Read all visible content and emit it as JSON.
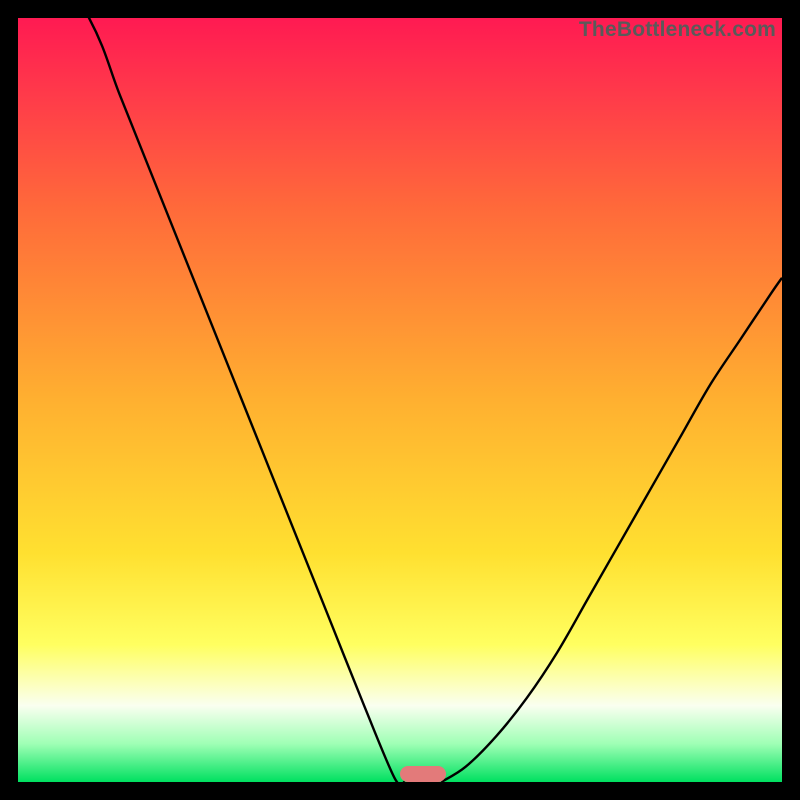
{
  "watermark": {
    "text": "TheBottleneck.com"
  },
  "marker": {
    "cx_pct": 53.0,
    "cy_pct": 99.0
  },
  "chart_data": {
    "type": "line",
    "title": "",
    "xlabel": "",
    "ylabel": "",
    "xlim": [
      0,
      100
    ],
    "ylim": [
      0,
      100
    ],
    "grid": false,
    "legend": false,
    "annotations": [
      {
        "text": "TheBottleneck.com",
        "position": "top-right"
      }
    ],
    "optimum_marker": {
      "x": 53,
      "y": 0,
      "color": "#e37a7a",
      "shape": "pill"
    },
    "series": [
      {
        "name": "bottleneck-left",
        "x": [
          0,
          9.3,
          13.3,
          17.3,
          21.3,
          25.3,
          29.3,
          33.3,
          37.3,
          41.3,
          45.3,
          49.3,
          50.6
        ],
        "values": [
          115,
          100,
          90,
          80,
          70,
          60,
          50,
          40,
          30,
          20,
          10,
          0.5,
          0
        ]
      },
      {
        "name": "bottleneck-right",
        "x": [
          55.4,
          58.6,
          62.6,
          66.6,
          70.6,
          74.6,
          78.6,
          82.6,
          86.6,
          90.6,
          94.6,
          98.6,
          100
        ],
        "values": [
          0,
          2,
          6,
          11,
          17,
          24,
          31,
          38,
          45,
          52,
          58,
          64,
          66
        ]
      }
    ],
    "background_gradient": {
      "direction": "vertical",
      "stops": [
        {
          "pct": 0,
          "color": "#ff1a52"
        },
        {
          "pct": 10,
          "color": "#ff3a4a"
        },
        {
          "pct": 25,
          "color": "#ff6a3a"
        },
        {
          "pct": 50,
          "color": "#ffb030"
        },
        {
          "pct": 70,
          "color": "#ffe030"
        },
        {
          "pct": 82,
          "color": "#ffff60"
        },
        {
          "pct": 90,
          "color": "#fafff0"
        },
        {
          "pct": 95,
          "color": "#9fffb5"
        },
        {
          "pct": 100,
          "color": "#00e060"
        }
      ]
    }
  }
}
